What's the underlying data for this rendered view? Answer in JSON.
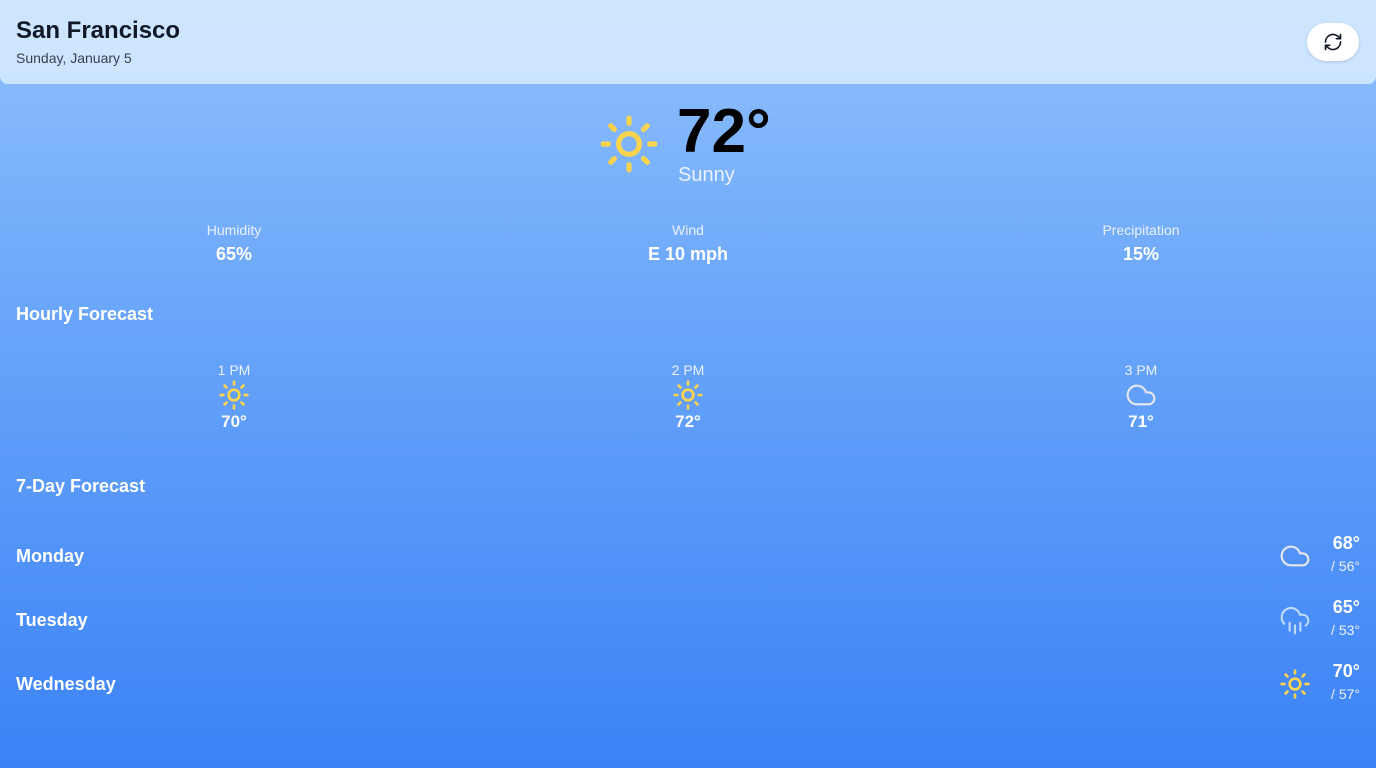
{
  "header": {
    "city": "San Francisco",
    "date": "Sunday, January 5",
    "refresh_icon": "refresh-icon"
  },
  "current": {
    "temp": "72°",
    "condition": "Sunny",
    "icon": "sun-icon"
  },
  "stats": [
    {
      "label": "Humidity",
      "value": "65%"
    },
    {
      "label": "Wind",
      "value": "E 10 mph"
    },
    {
      "label": "Precipitation",
      "value": "15%"
    }
  ],
  "hourly": {
    "title": "Hourly Forecast",
    "items": [
      {
        "time": "1 PM",
        "icon": "sun-icon",
        "temp": "70°"
      },
      {
        "time": "2 PM",
        "icon": "sun-icon",
        "temp": "72°"
      },
      {
        "time": "3 PM",
        "icon": "cloud-icon",
        "temp": "71°"
      }
    ]
  },
  "daily": {
    "title": "7-Day Forecast",
    "items": [
      {
        "day": "Monday",
        "icon": "cloud-icon",
        "high": "68°",
        "low": "/ 56°"
      },
      {
        "day": "Tuesday",
        "icon": "rain-cloud-icon",
        "high": "65°",
        "low": "/ 53°"
      },
      {
        "day": "Wednesday",
        "icon": "sun-icon",
        "high": "70°",
        "low": "/ 57°"
      }
    ]
  },
  "colors": {
    "sun": "#fcd34d",
    "gradient_top": "#91c1fc",
    "gradient_bottom": "#3b82f6",
    "header_bg": "#d6eafe"
  }
}
